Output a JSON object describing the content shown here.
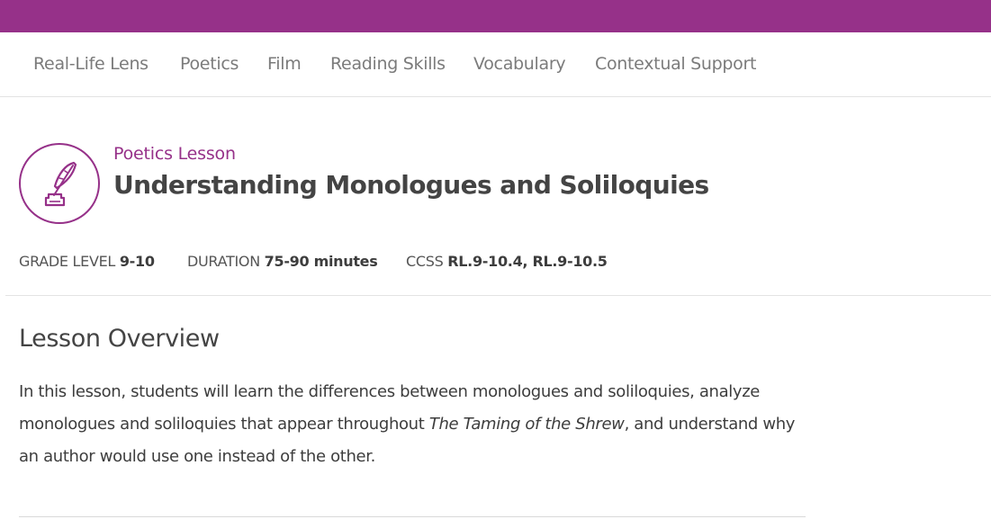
{
  "colors": {
    "brand": "#963189",
    "text": "#3d3d3d",
    "nav_text": "#7b7b7b",
    "divider": "#e3e3e3"
  },
  "nav": {
    "items": [
      {
        "label": "Real-Life Lens"
      },
      {
        "label": "Poetics"
      },
      {
        "label": "Film"
      },
      {
        "label": "Reading Skills"
      },
      {
        "label": "Vocabulary"
      },
      {
        "label": "Contextual Support"
      }
    ]
  },
  "lesson": {
    "icon": "quill-inkwell-icon",
    "type": "Poetics Lesson",
    "title": "Understanding Monologues and Soliloquies"
  },
  "meta": {
    "grade_label": "GRADE LEVEL",
    "grade_value": "9-10",
    "duration_label": "DURATION",
    "duration_value": "75-90 minutes",
    "ccss_label": "CCSS",
    "ccss_value": "RL.9-10.4, RL.9-10.5"
  },
  "overview": {
    "heading": "Lesson Overview",
    "body_before": "In this lesson, students will learn the differences between monologues and soliloquies, analyze monologues and soliloquies that appear throughout ",
    "body_italic": "The Taming of the Shrew",
    "body_after": ", and understand why an author would use one instead of the other."
  }
}
